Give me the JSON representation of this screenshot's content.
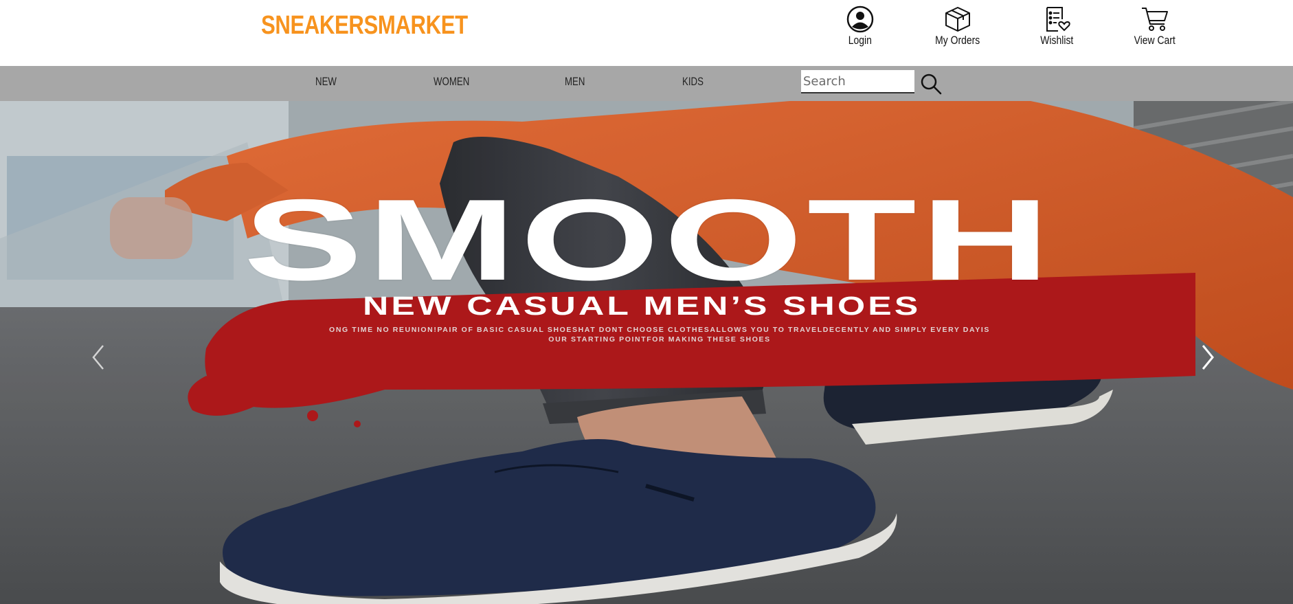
{
  "header": {
    "logo": "SNEAKERSMARKET",
    "logo_color": "#f7931e",
    "actions": [
      {
        "label": "Login",
        "icon": "user-circle-icon"
      },
      {
        "label": "My Orders",
        "icon": "package-box-icon"
      },
      {
        "label": "Wishlist",
        "icon": "wishlist-heart-icon"
      },
      {
        "label": "View Cart",
        "icon": "shopping-cart-icon"
      }
    ]
  },
  "nav": {
    "items": [
      "NEW",
      "WOMEN",
      "MEN",
      "KIDS"
    ],
    "search": {
      "placeholder": "Search",
      "value": "",
      "icon": "search-icon"
    },
    "background": "#a7a7a7"
  },
  "hero": {
    "title": "SMOOTH",
    "subtitle": "NEW CASUAL MEN’S SHOES",
    "description": "ONG TIME NO REUNION!PAIR OF BASIC CASUAL SHOESHAT DONT CHOOSE CLOTHESALLOWS YOU TO TRAVELDECENTLY AND SIMPLY EVERY DAYIS OUR STARTING POINTFOR MAKING THESE SHOES",
    "prev_icon": "chevron-left-icon",
    "next_icon": "chevron-right-icon",
    "accent_red": "#b3191c",
    "accent_orange": "#e0622c"
  }
}
